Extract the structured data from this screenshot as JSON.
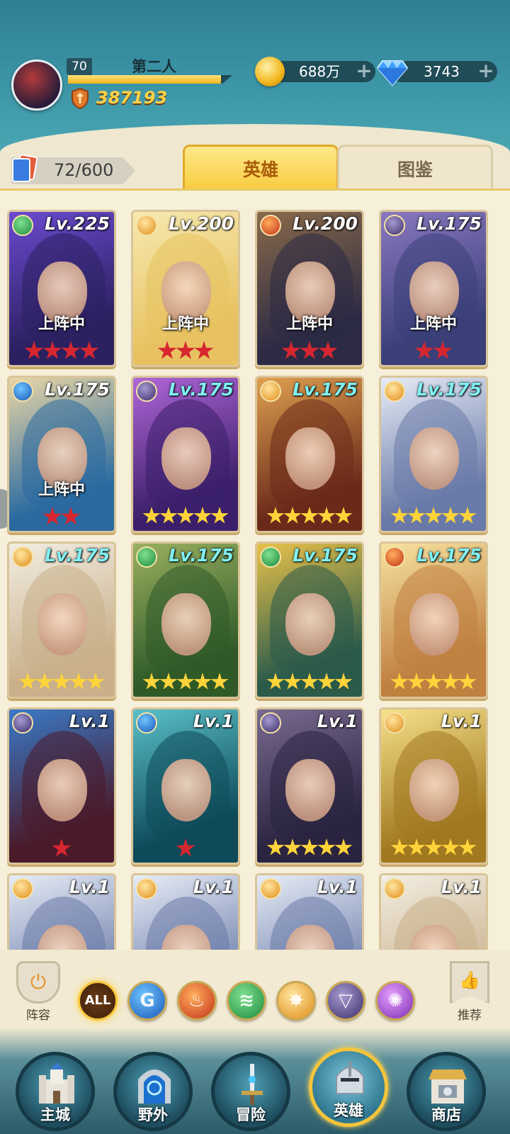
{
  "player": {
    "level": "70",
    "name": "第二人",
    "power": "387193",
    "xp_fraction": 0.93
  },
  "resources": {
    "gold": "688万",
    "diamonds": "3743"
  },
  "collection": {
    "count": "72/600"
  },
  "tabs": {
    "heroes": "英雄",
    "gallery": "图鉴"
  },
  "heroes": [
    {
      "level": "Lv.225",
      "element": "wind",
      "deployed": "上阵中",
      "stars": 4,
      "star_color": "red",
      "colors": [
        "#2b2060",
        "#6b4ad0"
      ]
    },
    {
      "level": "Lv.200",
      "element": "light",
      "deployed": "上阵中",
      "stars": 3,
      "star_color": "red",
      "colors": [
        "#e8c260",
        "#f6e9b0"
      ]
    },
    {
      "level": "Lv.200",
      "element": "fire",
      "deployed": "上阵中",
      "stars": 3,
      "star_color": "red",
      "colors": [
        "#2c2a44",
        "#8a6a4a"
      ]
    },
    {
      "level": "Lv.175",
      "element": "dark",
      "deployed": "上阵中",
      "stars": 2,
      "star_color": "red",
      "colors": [
        "#3a3f78",
        "#8a78c0"
      ]
    },
    {
      "level": "Lv.175",
      "element": "water",
      "deployed": "上阵中",
      "stars": 2,
      "star_color": "red",
      "colors": [
        "#2a6aa0",
        "#e9d6a6"
      ]
    },
    {
      "level": "Lv.175",
      "element": "dark",
      "deployed": "",
      "stars": 5,
      "star_color": "gold",
      "colors": [
        "#3b1f6a",
        "#b066d8"
      ]
    },
    {
      "level": "Lv.175",
      "element": "light",
      "deployed": "",
      "stars": 5,
      "star_color": "gold",
      "colors": [
        "#6a2a1a",
        "#e0a050"
      ]
    },
    {
      "level": "Lv.175",
      "element": "light",
      "deployed": "",
      "stars": 5,
      "star_color": "gold",
      "colors": [
        "#6a7aa8",
        "#e6ecf6"
      ]
    },
    {
      "level": "Lv.175",
      "element": "light",
      "deployed": "",
      "stars": 5,
      "star_color": "gold",
      "colors": [
        "#c9b08a",
        "#f2ede2"
      ]
    },
    {
      "level": "Lv.175",
      "element": "wind",
      "deployed": "",
      "stars": 5,
      "star_color": "gold",
      "colors": [
        "#2f5a28",
        "#9ab060"
      ]
    },
    {
      "level": "Lv.175",
      "element": "wind",
      "deployed": "",
      "stars": 5,
      "star_color": "gold",
      "colors": [
        "#2a5a4a",
        "#e8c24a"
      ]
    },
    {
      "level": "Lv.175",
      "element": "fire",
      "deployed": "",
      "stars": 5,
      "star_color": "gold",
      "colors": [
        "#c08040",
        "#f7e2a0"
      ]
    },
    {
      "level": "Lv.1",
      "element": "dark",
      "deployed": "",
      "stars": 1,
      "star_color": "red",
      "colors": [
        "#4a1a2a",
        "#3a7ac8"
      ]
    },
    {
      "level": "Lv.1",
      "element": "water",
      "deployed": "",
      "stars": 1,
      "star_color": "red",
      "colors": [
        "#0e4a5a",
        "#5ac0c8"
      ]
    },
    {
      "level": "Lv.1",
      "element": "dark",
      "deployed": "",
      "stars": 5,
      "star_color": "gold",
      "colors": [
        "#2a2440",
        "#7a6a90"
      ]
    },
    {
      "level": "Lv.1",
      "element": "light",
      "deployed": "",
      "stars": 5,
      "star_color": "gold",
      "colors": [
        "#a07820",
        "#f6e08a"
      ]
    },
    {
      "level": "Lv.1",
      "element": "light",
      "deployed": "",
      "stars": 0,
      "star_color": "gold",
      "colors": [
        "#6a7aa8",
        "#e6ecf6"
      ]
    },
    {
      "level": "Lv.1",
      "element": "light",
      "deployed": "",
      "stars": 0,
      "star_color": "gold",
      "colors": [
        "#6a7aa8",
        "#e6ecf6"
      ]
    },
    {
      "level": "Lv.1",
      "element": "light",
      "deployed": "",
      "stars": 0,
      "star_color": "gold",
      "colors": [
        "#6a7aa8",
        "#e6ecf6"
      ]
    },
    {
      "level": "Lv.1",
      "element": "light",
      "deployed": "",
      "stars": 0,
      "star_color": "gold",
      "colors": [
        "#c9b08a",
        "#f2ede2"
      ]
    }
  ],
  "filters": {
    "team_label": "阵容",
    "all_label": "ALL",
    "elements": [
      "water",
      "fire",
      "wind",
      "light",
      "dark",
      "arcane"
    ],
    "recommend_label": "推荐"
  },
  "nav": [
    {
      "label": "主城",
      "icon": "castle-icon",
      "active": false
    },
    {
      "label": "野外",
      "icon": "portal-icon",
      "active": false
    },
    {
      "label": "冒险",
      "icon": "sword-icon",
      "active": false
    },
    {
      "label": "英雄",
      "icon": "helmet-icon",
      "active": true
    },
    {
      "label": "商店",
      "icon": "shop-icon",
      "active": false
    }
  ]
}
